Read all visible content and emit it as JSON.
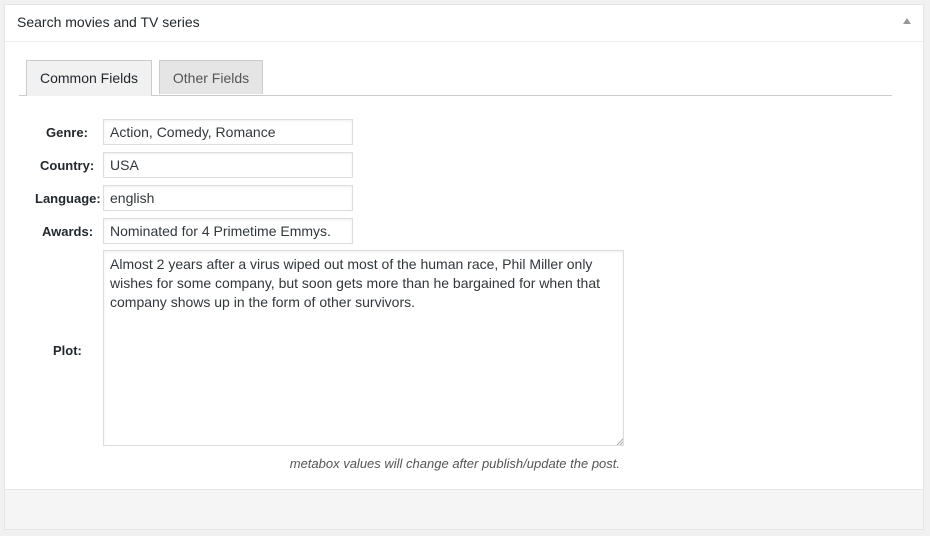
{
  "metabox": {
    "title": "Search movies and TV series"
  },
  "tabs": [
    {
      "label": "Common Fields",
      "active": true
    },
    {
      "label": "Other Fields",
      "active": false
    }
  ],
  "fields": {
    "genre": {
      "label": "Genre:",
      "value": "Action, Comedy, Romance"
    },
    "country": {
      "label": "Country:",
      "value": "USA"
    },
    "language": {
      "label": "Language:",
      "value": "english"
    },
    "awards": {
      "label": "Awards:",
      "value": "Nominated for 4 Primetime Emmys."
    },
    "plot": {
      "label": "Plot:",
      "value": "Almost 2 years after a virus wiped out most of the human race, Phil Miller only wishes for some company, but soon gets more than he bargained for when that company shows up in the form of other survivors."
    }
  },
  "note": "metabox values will change after publish/update the post.",
  "colors": {
    "tab_border": "#cccccc",
    "active_tab_bg": "#f1f1f1",
    "inactive_tab_bg": "#e5e5e5"
  }
}
